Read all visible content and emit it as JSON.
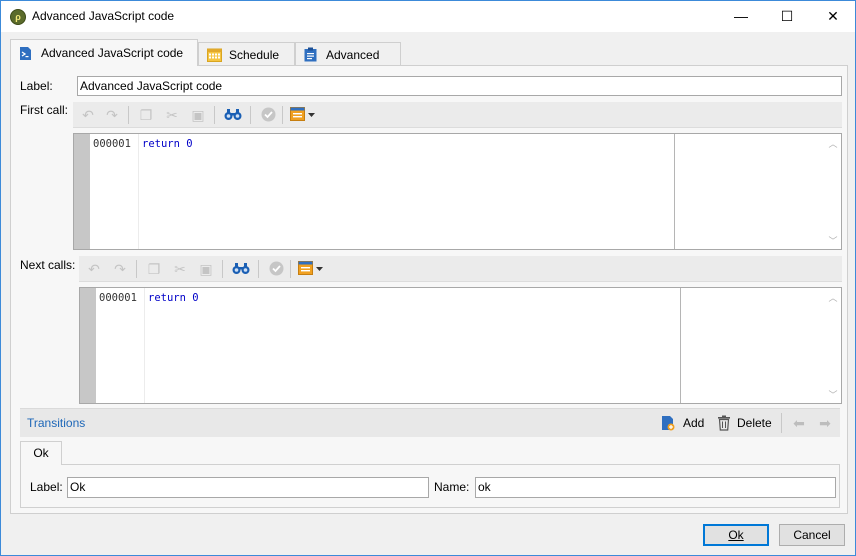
{
  "window": {
    "title": "Advanced JavaScript code",
    "minimize_glyph": "—",
    "maximize_glyph": "☐",
    "close_glyph": "✕"
  },
  "tabs": [
    {
      "label": "Advanced JavaScript code",
      "icon": "script-icon",
      "active": true
    },
    {
      "label": "Schedule",
      "icon": "calendar-icon",
      "active": false
    },
    {
      "label": "Advanced",
      "icon": "clipboard-icon",
      "active": false
    }
  ],
  "form": {
    "label_caption": "Label:",
    "label_value": "Advanced JavaScript code",
    "first_call_caption": "First call:",
    "next_calls_caption": "Next calls:"
  },
  "first_call_editor": {
    "line_number": "000001",
    "code": "return 0"
  },
  "next_calls_editor": {
    "line_number": "000001",
    "code": "return 0"
  },
  "toolbar_icons": [
    "undo-icon",
    "redo-icon",
    "copy-icon",
    "cut-icon",
    "paste-icon",
    "find-icon",
    "validate-icon",
    "insert-field-icon"
  ],
  "transitions": {
    "title": "Transitions",
    "add_label": "Add",
    "delete_label": "Delete"
  },
  "transition_tab": {
    "label": "Ok",
    "label_caption": "Label:",
    "label_value": "Ok",
    "name_caption": "Name:",
    "name_value": "ok"
  },
  "buttons": {
    "ok_label": "Ok",
    "cancel_label": "Cancel"
  },
  "colors": {
    "accent": "#0078d7",
    "link_blue": "#1e67b8",
    "code_blue": "#0000c8",
    "find_icon": "#1a5fb4",
    "insert_icon_orange": "#f0a020"
  }
}
